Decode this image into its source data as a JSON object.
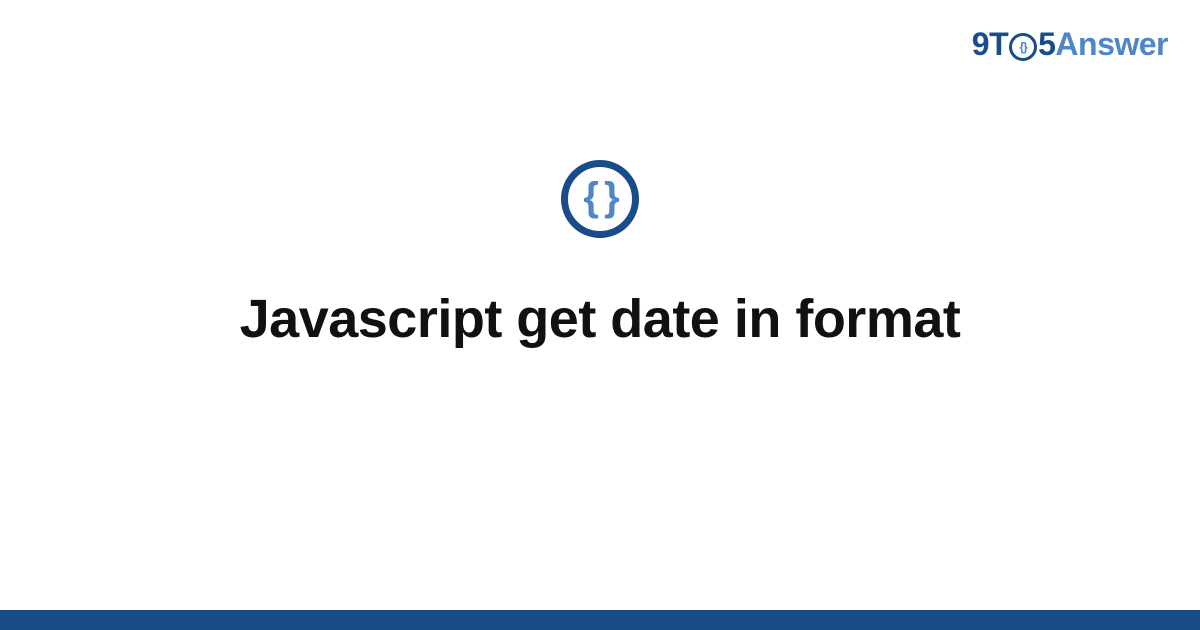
{
  "header": {
    "logo": {
      "part1": "9T",
      "part2_braces": "{}",
      "part3": "5",
      "part4": "Answer"
    }
  },
  "centerIcon": {
    "braces": "{ }"
  },
  "title": "Javascript get date in format",
  "colors": {
    "darkBlue": "#194d8a",
    "lightBlue": "#4f86c6"
  }
}
